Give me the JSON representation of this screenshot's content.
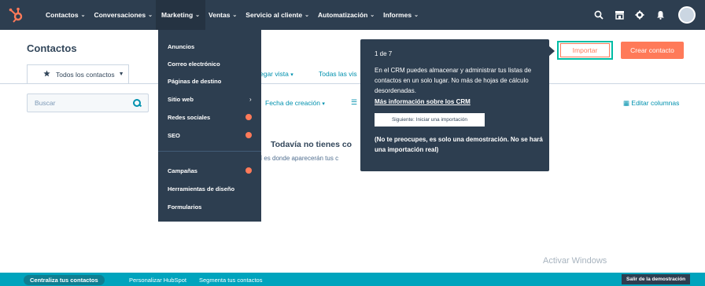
{
  "topnav": {
    "items": [
      {
        "label": "Contactos"
      },
      {
        "label": "Conversaciones"
      },
      {
        "label": "Marketing"
      },
      {
        "label": "Ventas"
      },
      {
        "label": "Servicio al cliente"
      },
      {
        "label": "Automatización"
      },
      {
        "label": "Informes"
      }
    ],
    "chevron": "⌄",
    "background": "#2d3e50"
  },
  "page": {
    "title": "Contactos",
    "import_label": "Importar",
    "create_label": "Crear contacto"
  },
  "tabs": {
    "active_label": "Todos los contactos",
    "add_view_label": "egar vista",
    "all_views_label": "Todas las vis"
  },
  "filters": {
    "search_placeholder": "Buscar",
    "date_label": "Fecha de creación",
    "edit_columns_label": "Editar columnas"
  },
  "empty_state": {
    "title": "Todavía no tienes co",
    "subtitle": "quí es donde aparecerán tus c"
  },
  "marketing_menu": {
    "items": [
      {
        "label": "Anuncios"
      },
      {
        "label": "Correo electrónico"
      },
      {
        "label": "Páginas de destino"
      },
      {
        "label": "Sitio web"
      },
      {
        "label": "Redes sociales"
      },
      {
        "label": "SEO"
      },
      {
        "label": "Campañas"
      },
      {
        "label": "Herramientas de diseño"
      },
      {
        "label": "Formularios"
      }
    ]
  },
  "tour": {
    "step": "1 de 7",
    "body": "En el CRM puedes almacenar y administrar tus listas de contactos en un solo lugar. No más de hojas de cálculo desordenadas.",
    "link": "Más información sobre los CRM",
    "button": "Siguiente: Iniciar una importación",
    "note": "(No te preocupes, es solo una demostración. No se hará una importación real)"
  },
  "watermark": "Activar Windows",
  "bottombar": {
    "items": [
      {
        "label": "Centraliza tus contactos"
      },
      {
        "label": "Personalizar HubSpot"
      },
      {
        "label": "Segmenta tus contactos"
      }
    ],
    "exit_label": "Salir de la demostración"
  },
  "colors": {
    "accent": "#ff7a59",
    "teal": "#00bda5",
    "link": "#0091ae",
    "bottom_bar": "#00a4bd"
  },
  "icons": [
    "hubspot-logo-icon",
    "search-icon",
    "marketplace-icon",
    "gear-icon",
    "bell-icon",
    "star-icon",
    "chevron-down-icon",
    "chevron-right-icon",
    "notification-dot-icon",
    "columns-icon",
    "filter-icon"
  ]
}
